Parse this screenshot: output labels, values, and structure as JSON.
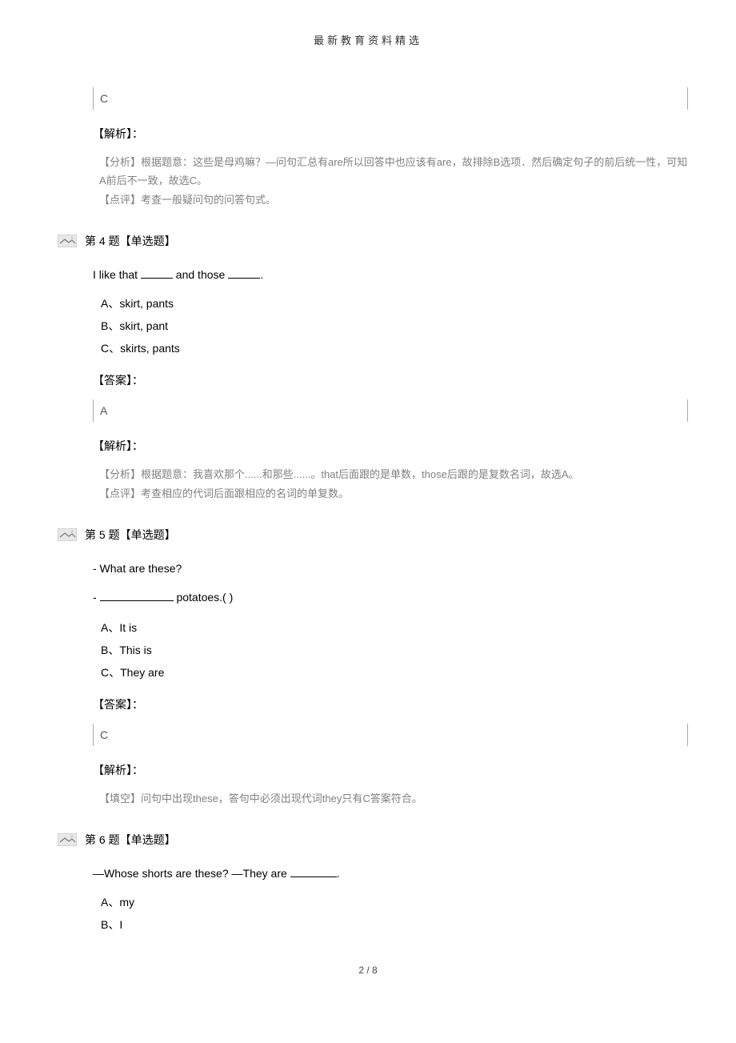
{
  "meta": {
    "header": "最新教育资料精选",
    "footer": "2 / 8"
  },
  "q3": {
    "answer_letter": "C",
    "label_analysis": "【解析】：",
    "analysis_line1": "【分析】根据题意：这些是母鸡嘛？—问句汇总有are所以回答中也应该有are，故排除B选项．然后确定句子的前后统一性，可知A前后不一致，故选C。",
    "analysis_line2": "【点评】考查一般疑问句的问答句式。"
  },
  "q4": {
    "header": "第 4 题【单选题】",
    "stem_pre": "I like that ",
    "stem_mid": " and those ",
    "stem_post": ".",
    "optA": "A、skirt, pants",
    "optB": "B、skirt, pant",
    "optC": "C、skirts, pants",
    "label_answer": "【答案】：",
    "answer_letter": "A",
    "label_analysis": "【解析】：",
    "analysis_line1": "【分析】根据题意：我喜欢那个......和那些......。that后面跟的是单数，those后跟的是复数名词，故选A。",
    "analysis_line2": "【点评】考查相应的代词后面跟相应的名词的单复数。"
  },
  "q5": {
    "header": "第 5 题【单选题】",
    "stem_line1": "- What are these?",
    "stem_line2_pre": "- ",
    "stem_line2_post": " potatoes.(        )",
    "optA": "A、It is",
    "optB": "B、This is",
    "optC": "C、They are",
    "label_answer": "【答案】：",
    "answer_letter": "C",
    "label_analysis": "【解析】：",
    "analysis_line1": "【填空】问句中出现these，答句中必须出现代词they只有C答案符合。"
  },
  "q6": {
    "header": "第 6 题【单选题】",
    "stem_pre": "—Whose shorts are these?   —They are ",
    "stem_post": ".",
    "optA": "A、my",
    "optB": "B、I"
  }
}
